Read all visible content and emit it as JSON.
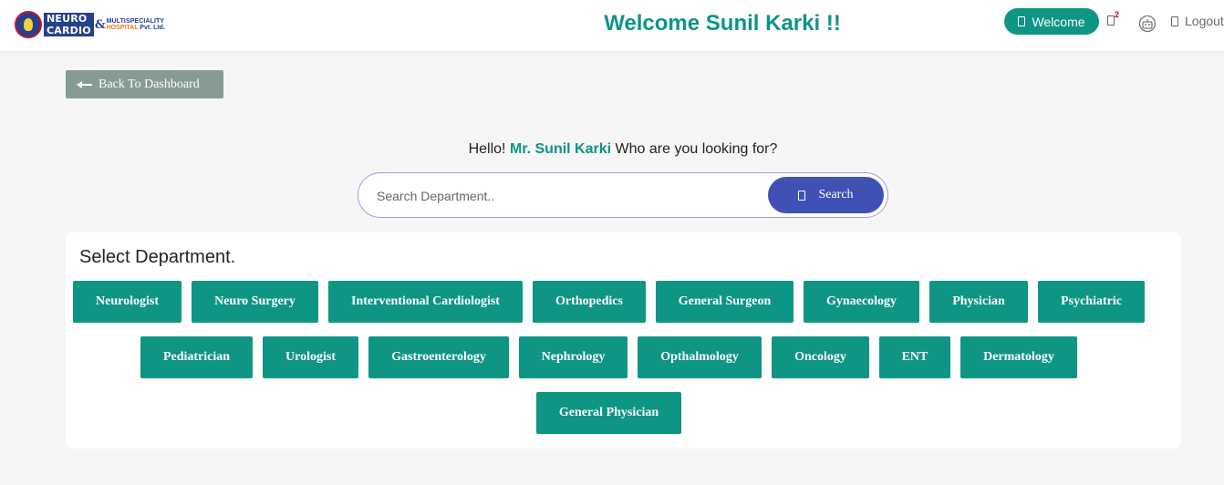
{
  "header": {
    "logo": {
      "line1": "NEURO",
      "line2": "CARDIO",
      "amp": "&",
      "sub1": "MULTISPECIALITY",
      "sub2": "HOSPITAL",
      "sub3": "Pvt. Ltd."
    },
    "title": "Welcome Sunil Karki !!",
    "welcome_button": "Welcome",
    "notification_count": "2",
    "logout_label": "Logout",
    "colors": {
      "brand_teal": "#0f9584",
      "title_teal": "#0d9488",
      "logo_blue": "#27408b",
      "logo_orange": "#e67e22",
      "badge_red": "#d0021b"
    }
  },
  "back_button": {
    "label": "Back To Dashboard"
  },
  "greeting": {
    "prefix": "Hello!",
    "name": "Mr. Sunil Karki",
    "suffix": "Who are you looking for?"
  },
  "search": {
    "placeholder": "Search Department..",
    "button_label": "Search",
    "button_color": "#3f51b5"
  },
  "departments": {
    "title": "Select Department.",
    "items": [
      "Neurologist",
      "Neuro Surgery",
      "Interventional Cardiologist",
      "Orthopedics",
      "General Surgeon",
      "Gynaecology",
      "Physician",
      "Psychiatric",
      "Pediatrician",
      "Urologist",
      "Gastroenterology",
      "Nephrology",
      "Opthalmology",
      "Oncology",
      "ENT",
      "Dermatology",
      "General Physician"
    ]
  }
}
